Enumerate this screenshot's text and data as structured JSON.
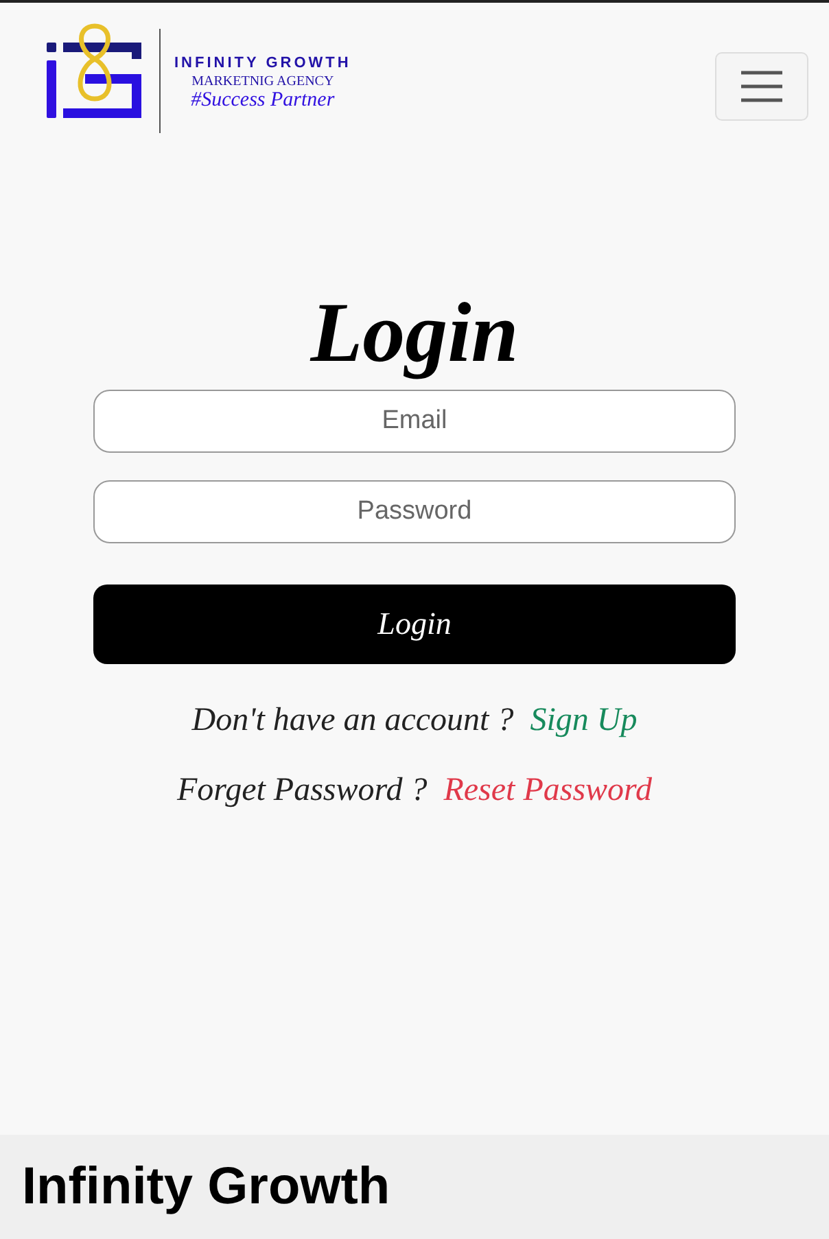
{
  "header": {
    "logo": {
      "name": "INFINITY GROWTH",
      "subtitle": "MARKETNIG AGENCY",
      "tagline": "#Success Partner"
    }
  },
  "login": {
    "title": "Login",
    "fields": [
      {
        "placeholder": "Email"
      },
      {
        "placeholder": "Password"
      }
    ],
    "button": "Login",
    "links": [
      {
        "prompt": "Don't have an account ?",
        "link": "Sign Up",
        "color": "#178a5c"
      },
      {
        "prompt": "Forget Password ?",
        "link": "Reset Password",
        "color": "#e0394a"
      }
    ]
  },
  "footer": {
    "title": "Infinity Growth"
  }
}
